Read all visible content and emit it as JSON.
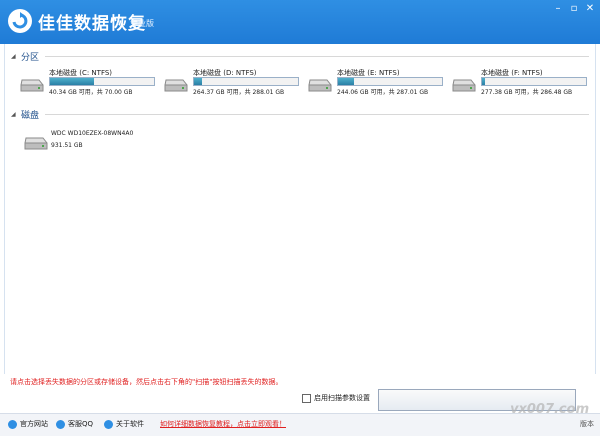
{
  "app": {
    "title": "佳佳数据恢复",
    "edition": "专业版"
  },
  "sections": {
    "partitions": "分区",
    "disks": "磁盘"
  },
  "partitions": [
    {
      "name": "本地磁盘 (C: NTFS)",
      "info": "40.34 GB 可用，共 70.00 GB",
      "used_fraction": 0.42
    },
    {
      "name": "本地磁盘 (D: NTFS)",
      "info": "264.37 GB 可用，共 288.01 GB",
      "used_fraction": 0.08
    },
    {
      "name": "本地磁盘 (E: NTFS)",
      "info": "244.06 GB 可用，共 287.01 GB",
      "used_fraction": 0.15
    },
    {
      "name": "本地磁盘 (F: NTFS)",
      "info": "277.38 GB 可用，共 286.48 GB",
      "used_fraction": 0.03
    }
  ],
  "disks": [
    {
      "name": "WDC WD10EZEX-08WN4A0",
      "size": "931.51 GB"
    }
  ],
  "hint": "请点击选择丢失数据的分区或存储设备，然后点击右下角的\"扫描\"按钮扫描丢失的数据。",
  "advanced_option": "启用扫描参数设置",
  "footer": {
    "site": "官方网站",
    "qq": "客服QQ",
    "about": "关于软件",
    "tutorial": "如何详细数据恢复教程，点击立即观看！",
    "version": "版本"
  },
  "colors": {
    "title_bar": "#2f8fe3",
    "accent": "#2a7fa6",
    "hint": "#e02020"
  },
  "icons": [
    "logo-icon",
    "minimize-icon",
    "maximize-icon",
    "close-icon",
    "hard-drive-icon",
    "globe-icon",
    "qq-icon",
    "info-icon"
  ]
}
